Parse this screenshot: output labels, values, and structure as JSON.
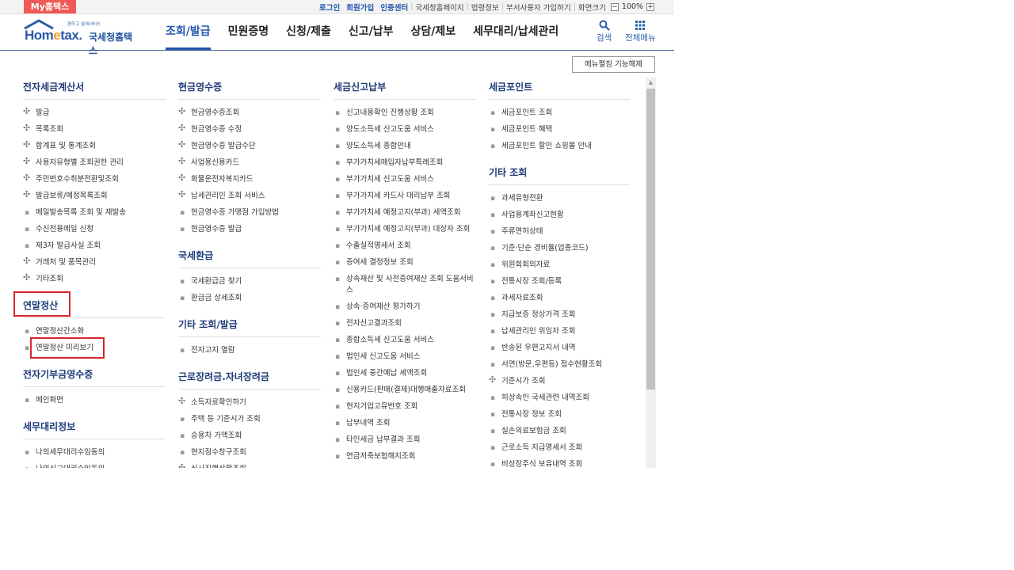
{
  "topbar": {
    "mytax": "My홈택스",
    "links": [
      "로그인",
      "회원가입",
      "인증센터"
    ],
    "links2": [
      "국세청홈페이지",
      "법령정보",
      "부서사용자 가입하기",
      "화면크기"
    ],
    "zoom_minus": "−",
    "zoom_value": "100%",
    "zoom_plus": "+"
  },
  "header": {
    "logo_sub": "편하고 설레서비스",
    "logo_text_a": "Hom",
    "logo_text_e": "e",
    "logo_text_b": "tax.",
    "logo_kor": "국세청홈택스",
    "nav": [
      "조회/발급",
      "민원증명",
      "신청/제출",
      "신고/납부",
      "상담/제보",
      "세무대리/납세관리"
    ],
    "search_label": "검색",
    "allmenu_label": "전체메뉴"
  },
  "unfold_button": "메뉴펼침 기능해제",
  "columns": [
    {
      "sections": [
        {
          "title": "전자세금계산서",
          "items": [
            {
              "label": "발급",
              "bullet": "plus"
            },
            {
              "label": "목록조회",
              "bullet": "plus"
            },
            {
              "label": "합계표 및 통계조회",
              "bullet": "plus"
            },
            {
              "label": "사용자유형별 조회권한 관리",
              "bullet": "plus"
            },
            {
              "label": "주민번호수취분전환및조회",
              "bullet": "plus"
            },
            {
              "label": "발급보류/예정목록조회",
              "bullet": "plus"
            },
            {
              "label": "메일발송목록 조회 및 재발송",
              "bullet": "dot"
            },
            {
              "label": "수신전용메일 신청",
              "bullet": "dot"
            },
            {
              "label": "제3자 발급사실 조회",
              "bullet": "dot"
            },
            {
              "label": "거래처 및 품목관리",
              "bullet": "plus"
            },
            {
              "label": "기타조회",
              "bullet": "plus"
            }
          ]
        },
        {
          "title": "연말정산",
          "items": [
            {
              "label": "연말정산간소화",
              "bullet": "dot"
            },
            {
              "label": "연말정산 미리보기",
              "bullet": "dot"
            }
          ]
        },
        {
          "title": "전자기부금영수증",
          "items": [
            {
              "label": "메인화면",
              "bullet": "dot"
            }
          ]
        },
        {
          "title": "세무대리정보",
          "items": [
            {
              "label": "나의세무대리수임동의",
              "bullet": "dot"
            },
            {
              "label": "나의신고대리수임동의",
              "bullet": "dot"
            }
          ]
        }
      ]
    },
    {
      "sections": [
        {
          "title": "현금영수증",
          "items": [
            {
              "label": "현금영수증조회",
              "bullet": "plus"
            },
            {
              "label": "현금영수증 수정",
              "bullet": "plus"
            },
            {
              "label": "현금영수증 발급수단",
              "bullet": "plus"
            },
            {
              "label": "사업용신용카드",
              "bullet": "plus"
            },
            {
              "label": "화물운전자복지카드",
              "bullet": "plus"
            },
            {
              "label": "납세관리인 조회 서비스",
              "bullet": "plus"
            },
            {
              "label": "현금영수증 가맹점 가입방법",
              "bullet": "dot"
            },
            {
              "label": "현금영수증 발급",
              "bullet": "dot"
            }
          ]
        },
        {
          "title": "국세환급",
          "items": [
            {
              "label": "국세환급금 찾기",
              "bullet": "dot"
            },
            {
              "label": "환급금 상세조회",
              "bullet": "dot"
            }
          ]
        },
        {
          "title": "기타 조회/발급",
          "items": [
            {
              "label": "전자고지 열람",
              "bullet": "dot"
            }
          ]
        },
        {
          "title": "근로장려금.자녀장려금",
          "items": [
            {
              "label": "소득자료확인하기",
              "bullet": "plus"
            },
            {
              "label": "주택 등 기준시가 조회",
              "bullet": "dot"
            },
            {
              "label": "승용차 가액조회",
              "bullet": "dot"
            },
            {
              "label": "현지점수창구조회",
              "bullet": "dot"
            },
            {
              "label": "심사진행상황조회",
              "bullet": "plus"
            }
          ]
        }
      ]
    },
    {
      "sections": [
        {
          "title": "세금신고납부",
          "items": [
            {
              "label": "신고내용확인 진행상황 조회",
              "bullet": "dot"
            },
            {
              "label": "양도소득세 신고도움 서비스",
              "bullet": "dot"
            },
            {
              "label": "양도소득세 종합안내",
              "bullet": "dot"
            },
            {
              "label": "부가가치세매입자납부특례조회",
              "bullet": "dot"
            },
            {
              "label": "부가가치세 신고도움 서비스",
              "bullet": "dot"
            },
            {
              "label": "부가가치세 카드사 대리납부 조회",
              "bullet": "dot"
            },
            {
              "label": "부가가치세 예정고지(부과) 세액조회",
              "bullet": "dot"
            },
            {
              "label": "부가가치세 예정고지(부과) 대상자 조회",
              "bullet": "dot"
            },
            {
              "label": "수출실적명세서 조회",
              "bullet": "dot"
            },
            {
              "label": "증여세 결정정보 조회",
              "bullet": "dot"
            },
            {
              "label": "상속재산 및 사전증여재산 조회 도움서비스",
              "bullet": "dot"
            },
            {
              "label": "상속·증여재산 평가하기",
              "bullet": "dot"
            },
            {
              "label": "전자신고결과조회",
              "bullet": "dot"
            },
            {
              "label": "종합소득세 신고도움 서비스",
              "bullet": "dot"
            },
            {
              "label": "법인세 신고도움 서비스",
              "bullet": "dot"
            },
            {
              "label": "법인세 중간예납 세액조회",
              "bullet": "dot"
            },
            {
              "label": "신용카드(판매(결제)대행매출자료조회",
              "bullet": "dot"
            },
            {
              "label": "현지기업고유번호 조회",
              "bullet": "dot"
            },
            {
              "label": "납부내역 조회",
              "bullet": "dot"
            },
            {
              "label": "타인세금 납부결과 조회",
              "bullet": "dot"
            },
            {
              "label": "연금저축보험해지조회",
              "bullet": "dot"
            }
          ]
        }
      ]
    },
    {
      "sections": [
        {
          "title": "세금포인트",
          "items": [
            {
              "label": "세금포인트 조회",
              "bullet": "dot"
            },
            {
              "label": "세금포인트 혜택",
              "bullet": "dot"
            },
            {
              "label": "세금포인트 할인 쇼핑몰 안내",
              "bullet": "dot"
            }
          ]
        },
        {
          "title": "기타 조회",
          "items": [
            {
              "label": "과세유형전환",
              "bullet": "dot"
            },
            {
              "label": "사업용계좌신고현황",
              "bullet": "dot"
            },
            {
              "label": "주류면허상태",
              "bullet": "dot"
            },
            {
              "label": "기준·단순 경비율(업종코드)",
              "bullet": "dot"
            },
            {
              "label": "위원회회의자료",
              "bullet": "dot"
            },
            {
              "label": "전통시장 조회/등록",
              "bullet": "dot"
            },
            {
              "label": "과세자료조회",
              "bullet": "dot"
            },
            {
              "label": "지급보증 정상가격 조회",
              "bullet": "dot"
            },
            {
              "label": "납세관리인 위임자 조회",
              "bullet": "dot"
            },
            {
              "label": "반송된 우편고지서 내역",
              "bullet": "dot"
            },
            {
              "label": "서면(방문,우편등) 접수현황조회",
              "bullet": "dot"
            },
            {
              "label": "기준시가 조회",
              "bullet": "plus"
            },
            {
              "label": "피상속인 국세관련 내역조회",
              "bullet": "dot"
            },
            {
              "label": "전통시장 정보 조회",
              "bullet": "dot"
            },
            {
              "label": "실손의료보험금 조회",
              "bullet": "dot"
            },
            {
              "label": "근로소득 지급명세서 조회",
              "bullet": "dot"
            },
            {
              "label": "비상장주식 보유내역 조회",
              "bullet": "dot"
            }
          ]
        }
      ]
    }
  ],
  "colors": {
    "accent": "#2255aa",
    "title": "#1e3c78",
    "highlight": "#d8262c",
    "mytax": "#ef5a54"
  }
}
